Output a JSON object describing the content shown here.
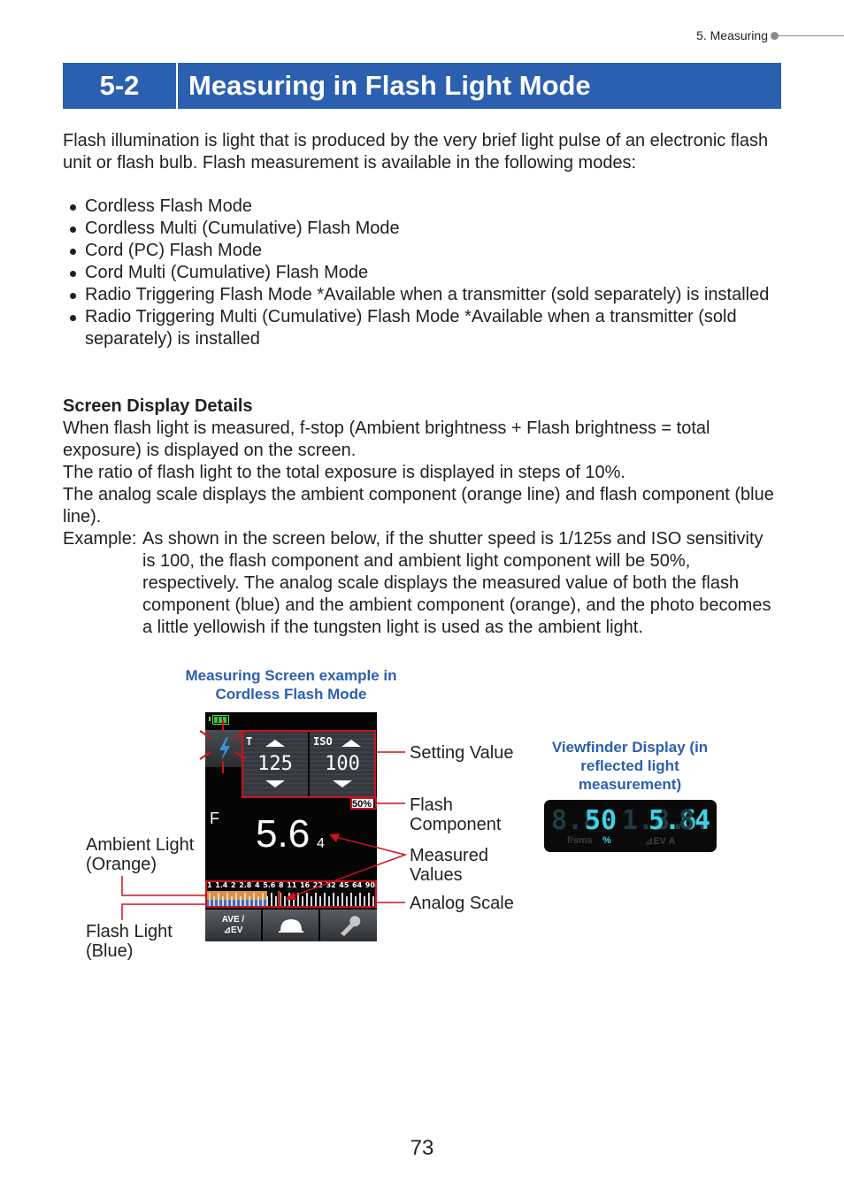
{
  "header": {
    "breadcrumb": "5.  Measuring",
    "section_number": "5-2",
    "section_title": "Measuring in Flash Light Mode"
  },
  "intro": "Flash illumination is light that is produced by the very brief light pulse of an electronic flash unit or flash bulb. Flash measurement is available in the following modes:",
  "modes": [
    "Cordless Flash Mode",
    "Cordless Multi (Cumulative) Flash Mode",
    "Cord (PC) Flash Mode",
    "Cord Multi (Cumulative) Flash Mode",
    "Radio Triggering Flash Mode *Available when a transmitter (sold separately) is installed",
    "Radio Triggering Multi (Cumulative) Flash Mode *Available when a transmitter (sold separately) is installed"
  ],
  "screen_display": {
    "heading": "Screen Display Details",
    "p1": "When flash light is measured, f-stop (Ambient brightness + Flash brightness = total exposure) is displayed on the screen.",
    "p2": "The ratio of flash light to the total exposure is displayed in steps of 10%.",
    "p3": "The analog scale displays the ambient component (orange line) and flash component (blue line).",
    "example_label": "Example:",
    "example_text": "As shown in the screen below, if the shutter speed is 1/125s and ISO sensitivity is 100, the flash component and ambient light component will be 50%, respectively. The analog scale displays the measured value of both the flash component (blue) and the ambient component (orange), and the photo becomes a little yellowish if the tungsten light is used as the ambient light."
  },
  "figure": {
    "caption": "Measuring Screen example in Cordless Flash Mode",
    "screen": {
      "shutter_label": "T",
      "shutter_value": "125",
      "iso_label": "ISO",
      "iso_value": "100",
      "flash_percent": "50%",
      "f_label": "F",
      "f_value": "5.6",
      "f_sub": "4",
      "scale_ticks": [
        "1",
        "1.4",
        "2",
        "2.8",
        "4",
        "5.6",
        "8",
        "11",
        "16",
        "22",
        "32",
        "45",
        "64",
        "90"
      ],
      "ambient_ratio": 0.5,
      "flash_ratio": 0.5,
      "btn_ave_line1": "AVE /",
      "btn_ave_line2": "⊿EV"
    },
    "callouts": {
      "setting_value": "Setting Value",
      "flash_component": "Flash Component",
      "measured_values": "Measured Values",
      "analog_scale": "Analog Scale",
      "ambient_light": "Ambient Light (Orange)",
      "flash_light": "Flash Light (Blue)"
    },
    "colors": {
      "ambient": "#e08f3a",
      "flash": "#3d6cc4",
      "callout": "#d0101c",
      "accent": "#2b5fb0"
    }
  },
  "viewfinder": {
    "caption": "Viewfinder Display (in reflected light measurement)",
    "dim_left": "8.8",
    "percent_value": "50",
    "dim_mid": "1.8.",
    "f_value": "5.6",
    "dim_right": "8.",
    "sub_value": "4",
    "units_left": "f/sms",
    "units_pct": "%",
    "units_right": "⊿EV A"
  },
  "footer": {
    "page_number": "73"
  }
}
